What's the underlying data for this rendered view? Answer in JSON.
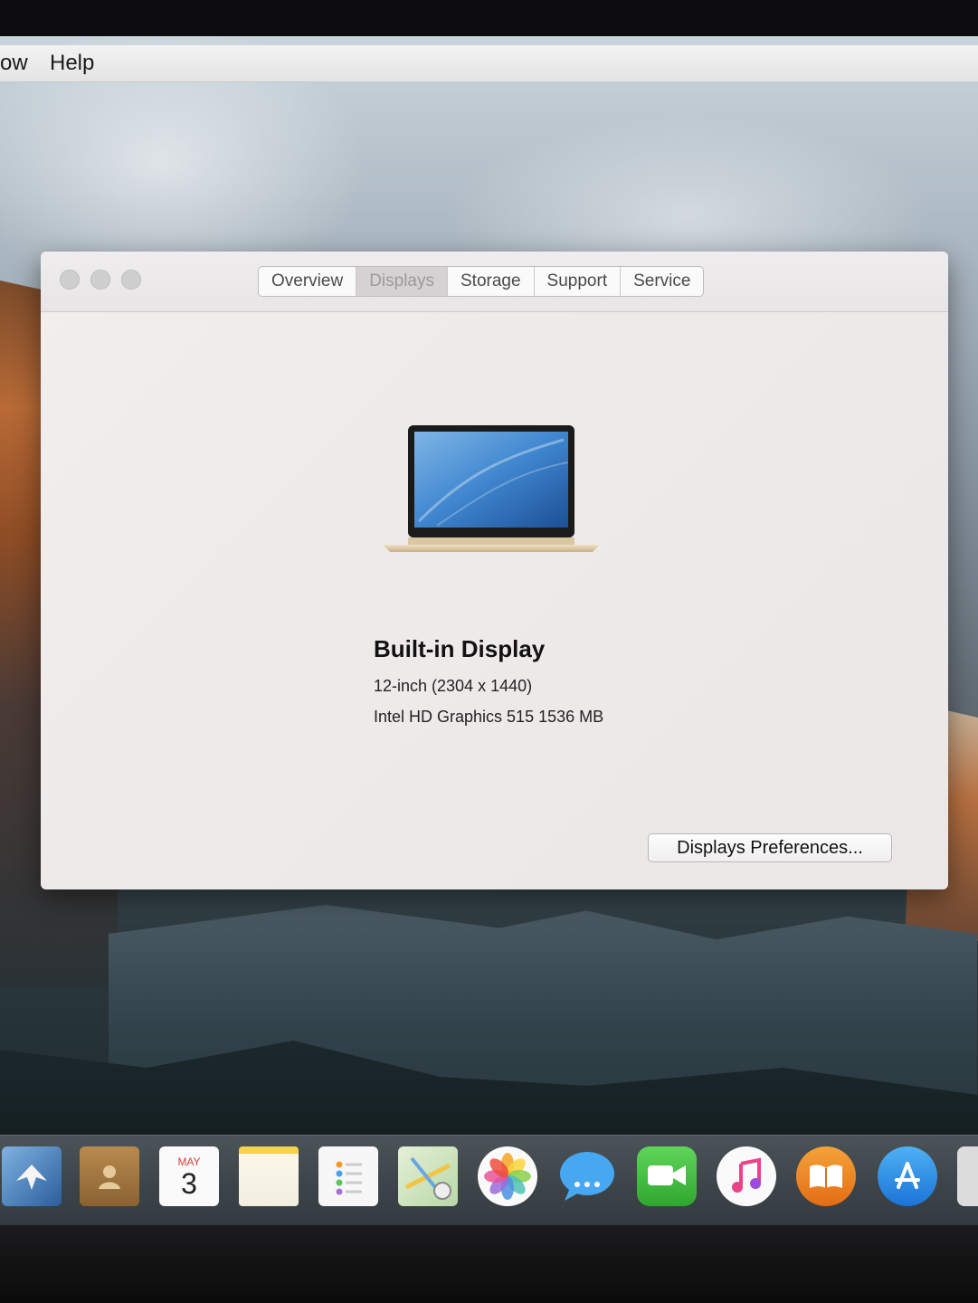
{
  "menubar": {
    "items": [
      "ow",
      "Help"
    ]
  },
  "window": {
    "tabs": [
      "Overview",
      "Displays",
      "Storage",
      "Support",
      "Service"
    ],
    "active_tab": "Displays",
    "display": {
      "title": "Built-in Display",
      "size_resolution": "12-inch (2304 x 1440)",
      "graphics": "Intel HD Graphics 515 1536 MB"
    },
    "preferences_button": "Displays Preferences..."
  },
  "dock": {
    "calendar_month": "MAY",
    "calendar_day": "3",
    "icons": [
      "mail-icon",
      "contacts-icon",
      "calendar-icon",
      "notes-icon",
      "reminders-icon",
      "maps-icon",
      "photos-icon",
      "messages-icon",
      "facetime-icon",
      "itunes-icon",
      "ibooks-icon",
      "app-store-icon"
    ]
  }
}
